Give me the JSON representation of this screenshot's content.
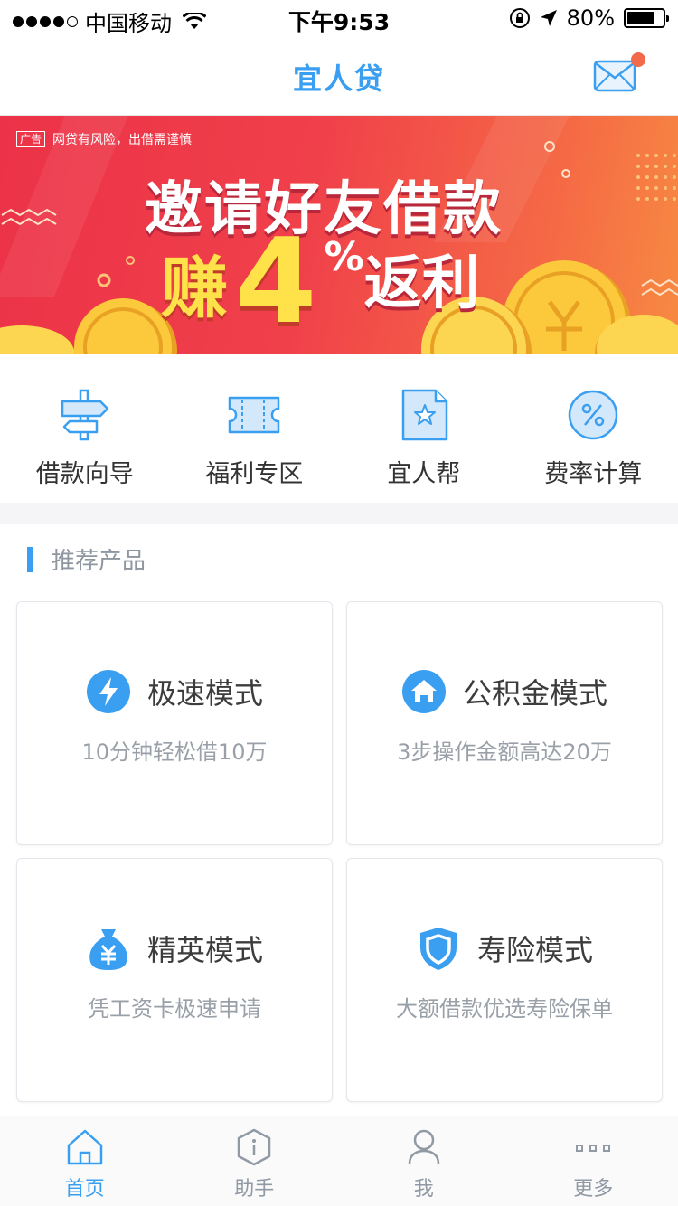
{
  "status": {
    "carrier": "中国移动",
    "time": "下午9:53",
    "battery": "80%",
    "battery_level": 0.8
  },
  "nav": {
    "title": "宜人贷",
    "has_unread": true
  },
  "banner": {
    "ad_tag": "广告",
    "disclaimer": "网贷有风险，出借需谨慎",
    "headline": "邀请好友借款",
    "earn": "赚",
    "number": "4",
    "percent": "%",
    "rebate": "返利"
  },
  "quick_entries": [
    {
      "label": "借款向导",
      "icon": "signpost-icon"
    },
    {
      "label": "福利专区",
      "icon": "ticket-icon"
    },
    {
      "label": "宜人帮",
      "icon": "star-document-icon"
    },
    {
      "label": "费率计算",
      "icon": "percent-icon"
    }
  ],
  "section": {
    "title": "推荐产品"
  },
  "products": [
    {
      "title": "极速模式",
      "desc": "10分钟轻松借10万",
      "icon": "lightning-icon"
    },
    {
      "title": "公积金模式",
      "desc": "3步操作金额高达20万",
      "icon": "home-icon"
    },
    {
      "title": "精英模式",
      "desc": "凭工资卡极速申请",
      "icon": "money-bag-icon"
    },
    {
      "title": "寿险模式",
      "desc": "大额借款优选寿险保单",
      "icon": "shield-icon"
    }
  ],
  "tabs": [
    {
      "label": "首页",
      "icon": "home-outline-icon",
      "active": true
    },
    {
      "label": "助手",
      "icon": "info-hexagon-icon",
      "active": false
    },
    {
      "label": "我",
      "icon": "person-icon",
      "active": false
    },
    {
      "label": "更多",
      "icon": "more-dots-icon",
      "active": false
    }
  ],
  "colors": {
    "accent": "#3a9ff0",
    "badge": "#f26a4a",
    "banner_start": "#ec3248",
    "banner_end": "#f78a42",
    "banner_highlight": "#ffe14a"
  }
}
